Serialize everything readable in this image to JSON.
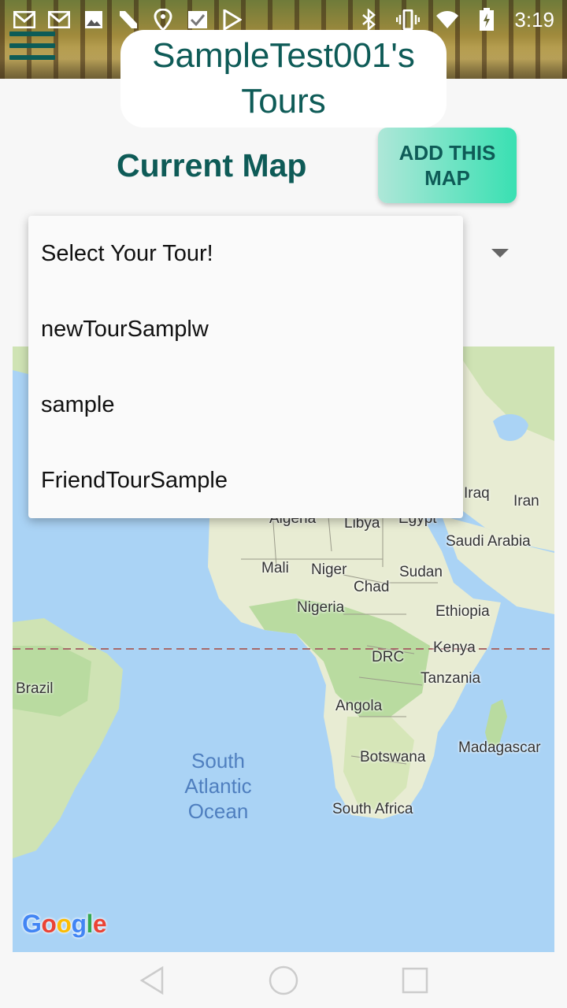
{
  "status_bar": {
    "time": "3:19",
    "icons": [
      "gmail-icon",
      "gmail-icon",
      "image-icon",
      "n-icon",
      "maps-icon",
      "check-icon",
      "play-store-icon",
      "bluetooth-icon",
      "vibrate-icon",
      "wifi-icon",
      "battery-charging-icon"
    ]
  },
  "header": {
    "title": "SampleTest001's Tours",
    "menu_icon": "hamburger-icon"
  },
  "main": {
    "current_map_label": "Current Map",
    "add_button_label": "ADD THIS MAP"
  },
  "dropdown": {
    "items": [
      "Select Your Tour!",
      "newTourSamplw",
      "sample",
      "FriendTourSample"
    ]
  },
  "map": {
    "countries": {
      "algeria": "Algeria",
      "libya": "Libya",
      "egypt": "Egypt",
      "iraq": "Iraq",
      "iran": "Iran",
      "saudi_arabia": "Saudi Arabia",
      "mali": "Mali",
      "niger": "Niger",
      "sudan": "Sudan",
      "chad": "Chad",
      "nigeria": "Nigeria",
      "ethiopia": "Ethiopia",
      "kenya": "Kenya",
      "drc": "DRC",
      "brazil": "Brazil",
      "tanzania": "Tanzania",
      "angola": "Angola",
      "madagascar": "Madagascar",
      "botswana": "Botswana",
      "south_africa": "South Africa"
    },
    "ocean_label": "South Atlantic Ocean",
    "attribution": "Google",
    "colors": {
      "water": "#aad3f5",
      "land": "#e8ecd3",
      "vegetation": "#b9dba0",
      "equator": "#a86a6a"
    }
  },
  "colors": {
    "accent": "#0e5b57",
    "button_gradient_start": "#aee7d8",
    "button_gradient_end": "#39e0b2"
  }
}
